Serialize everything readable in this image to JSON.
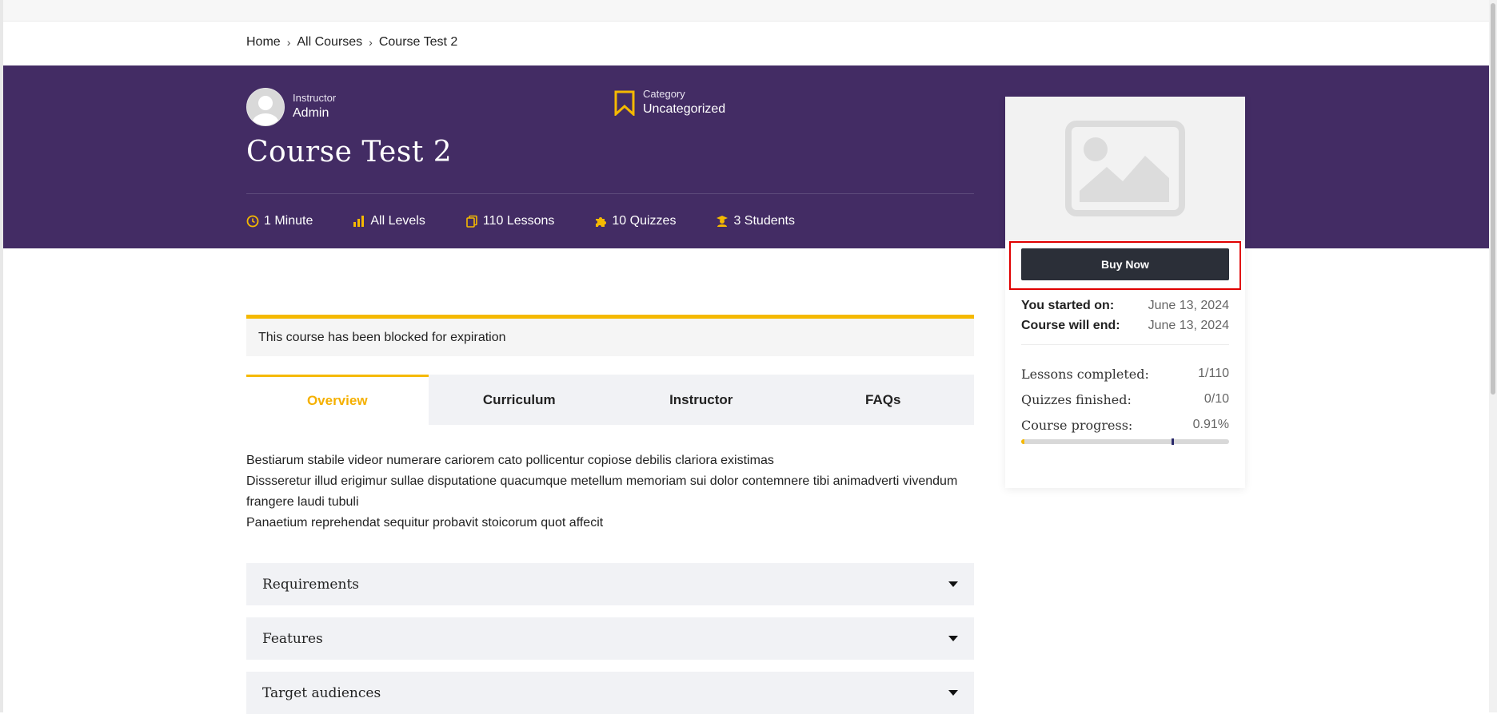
{
  "breadcrumb": {
    "home": "Home",
    "all_courses": "All Courses",
    "current": "Course Test 2"
  },
  "instructor": {
    "label": "Instructor",
    "name": "Admin"
  },
  "category": {
    "label": "Category",
    "name": "Uncategorized"
  },
  "course": {
    "title": "Course Test 2"
  },
  "stats": {
    "duration": "1 Minute",
    "level": "All Levels",
    "lessons": "110 Lessons",
    "quizzes": "10 Quizzes",
    "students": "3 Students"
  },
  "notice": "This course has been blocked for expiration",
  "tabs": [
    {
      "label": "Overview",
      "active": true
    },
    {
      "label": "Curriculum",
      "active": false
    },
    {
      "label": "Instructor",
      "active": false
    },
    {
      "label": "FAQs",
      "active": false
    }
  ],
  "overview": {
    "line1": "Bestiarum stabile videor numerare cariorem cato pollicentur copiose debilis clariora existimas",
    "line2": "Dissseretur illud erigimur sullae disputatione quacumque metellum memoriam sui dolor contemnere tibi animadverti vivendum frangere laudi tubuli",
    "line3": "Panaetium reprehendat sequitur probavit stoicorum quot affecit"
  },
  "accordions": [
    "Requirements",
    "Features",
    "Target audiences"
  ],
  "sidebar": {
    "buy_label": "Buy Now",
    "started_label": "You started on:",
    "started_value": "June 13, 2024",
    "end_label": "Course will end:",
    "end_value": "June 13, 2024",
    "lessons_label": "Lessons completed:",
    "lessons_value": "1/110",
    "quizzes_label": "Quizzes finished:",
    "quizzes_value": "0/10",
    "progress_label": "Course progress:",
    "progress_value": "0.91%",
    "progress_fraction": 0.0091
  },
  "colors": {
    "hero_bg": "#432c64",
    "accent": "#f5b900",
    "button_bg": "#2b2f38",
    "highlight": "#e00000"
  },
  "icons": [
    "avatar-placeholder-icon",
    "bookmark-icon",
    "clock-icon",
    "bar-chart-icon",
    "copy-icon",
    "puzzle-icon",
    "student-icon",
    "image-placeholder-icon",
    "caret-down-icon"
  ]
}
